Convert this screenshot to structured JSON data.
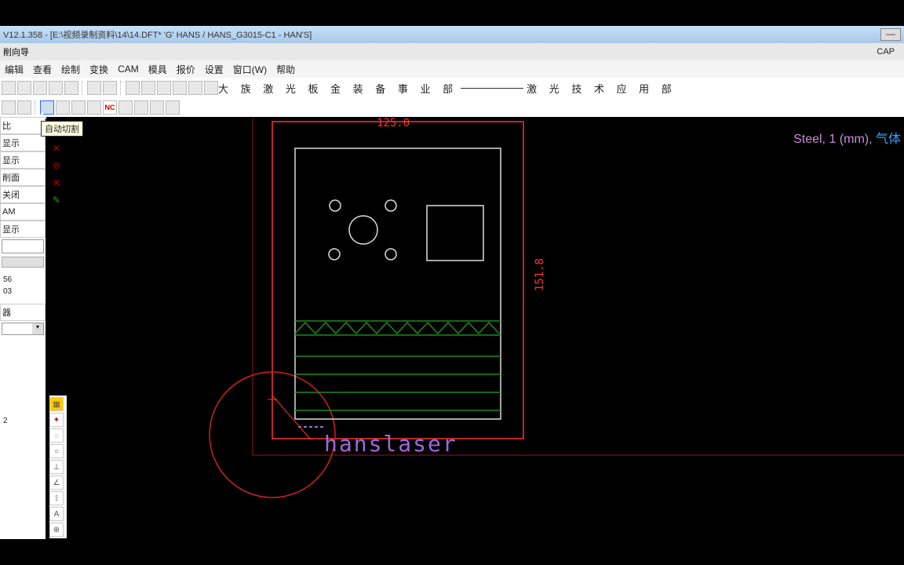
{
  "title": "V12.1.358 - [E:\\视频录制资料\\14\\14.DFT*  'G' HANS / HANS_G3015-C1         - HAN'S]",
  "sub_left": "削向导",
  "cap": "CAP",
  "menu": {
    "m1": "编辑",
    "m2": "查看",
    "m3": "绘制",
    "m4": "变换",
    "m5": "CAM",
    "m6": "模具",
    "m7": "报价",
    "m8": "设置",
    "m9": "窗口(W)",
    "m10": "帮助"
  },
  "banner": {
    "left": "大 族 激 光 板 金 装 备 事 业 部",
    "right": "激 光 技 术 应 用 部"
  },
  "tooltip": "自动切割",
  "nc_label": "NC",
  "side": {
    "i0": "比",
    "i1": "显示",
    "i2": "显示",
    "i3": "削面",
    "i4": "关闭",
    "i5": "AM",
    "i6": "显示",
    "n1": "56",
    "n2": "03",
    "n3": "器",
    "n4": "2"
  },
  "drawing": {
    "brand": "hanslaser",
    "dim_top": "125.0",
    "dim_right": "151.8",
    "info_steel": "Steel, 1 (mm), ",
    "info_gas": "气体"
  }
}
